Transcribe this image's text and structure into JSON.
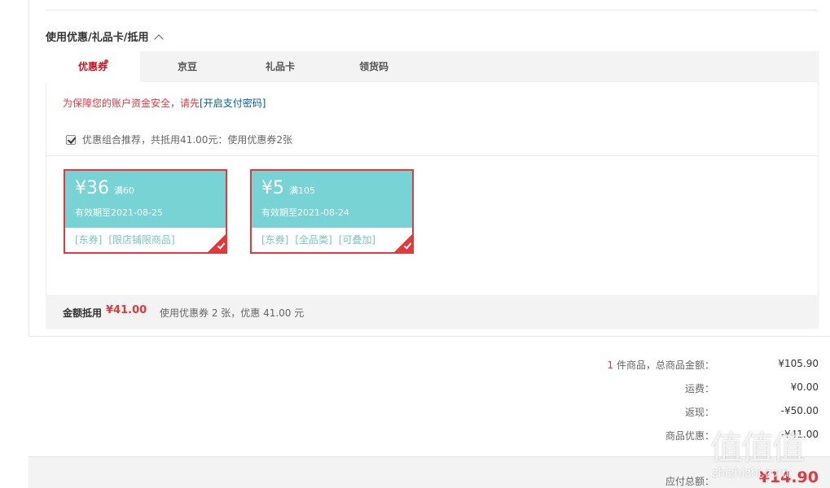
{
  "section": {
    "title": "使用优惠/礼品卡/抵用"
  },
  "tabs": [
    {
      "label": "优惠券",
      "active": true,
      "has_dot": true
    },
    {
      "label": "京豆",
      "active": false
    },
    {
      "label": "礼品卡",
      "active": false
    },
    {
      "label": "领货码",
      "active": false
    }
  ],
  "security": {
    "message": "为保障您的账户资金安全，请先",
    "link_label": "[开启支付密码]"
  },
  "combo": {
    "checked": true,
    "label": "优惠组合推荐，共抵用41.00元：使用优惠券2张"
  },
  "coupons": [
    {
      "amount": "¥36",
      "condition": "满60",
      "validity": "有效期至2021-08-25",
      "tags": [
        "[东券]",
        "[限店铺限商品]"
      ],
      "selected": true
    },
    {
      "amount": "¥5",
      "condition": "满105",
      "validity": "有效期至2021-08-24",
      "tags": [
        "[东券]",
        "[全品类]",
        "[可叠加]"
      ],
      "selected": true
    }
  ],
  "summary": {
    "label": "金额抵用",
    "amount": "¥41.00",
    "desc": "使用优惠券 2 张，优惠 41.00 元"
  },
  "totals": {
    "item_count": "1",
    "goods_label": " 件商品，总商品金额：",
    "goods_value": "¥105.90",
    "shipping_label": "运费：",
    "shipping_value": "¥0.00",
    "cashback_label": "返现：",
    "cashback_value": "-¥50.00",
    "discount_label": "商品优惠：",
    "discount_value": "-¥41.00",
    "payable_label": "应付总额：",
    "payable_value": "¥14.90"
  },
  "watermark": {
    "logo": "值值值",
    "text": "zhizhizhi.com"
  },
  "colors": {
    "accent_red": "#e4393c",
    "coupon_teal": "#77d3d4",
    "link_blue": "#005ea7"
  }
}
